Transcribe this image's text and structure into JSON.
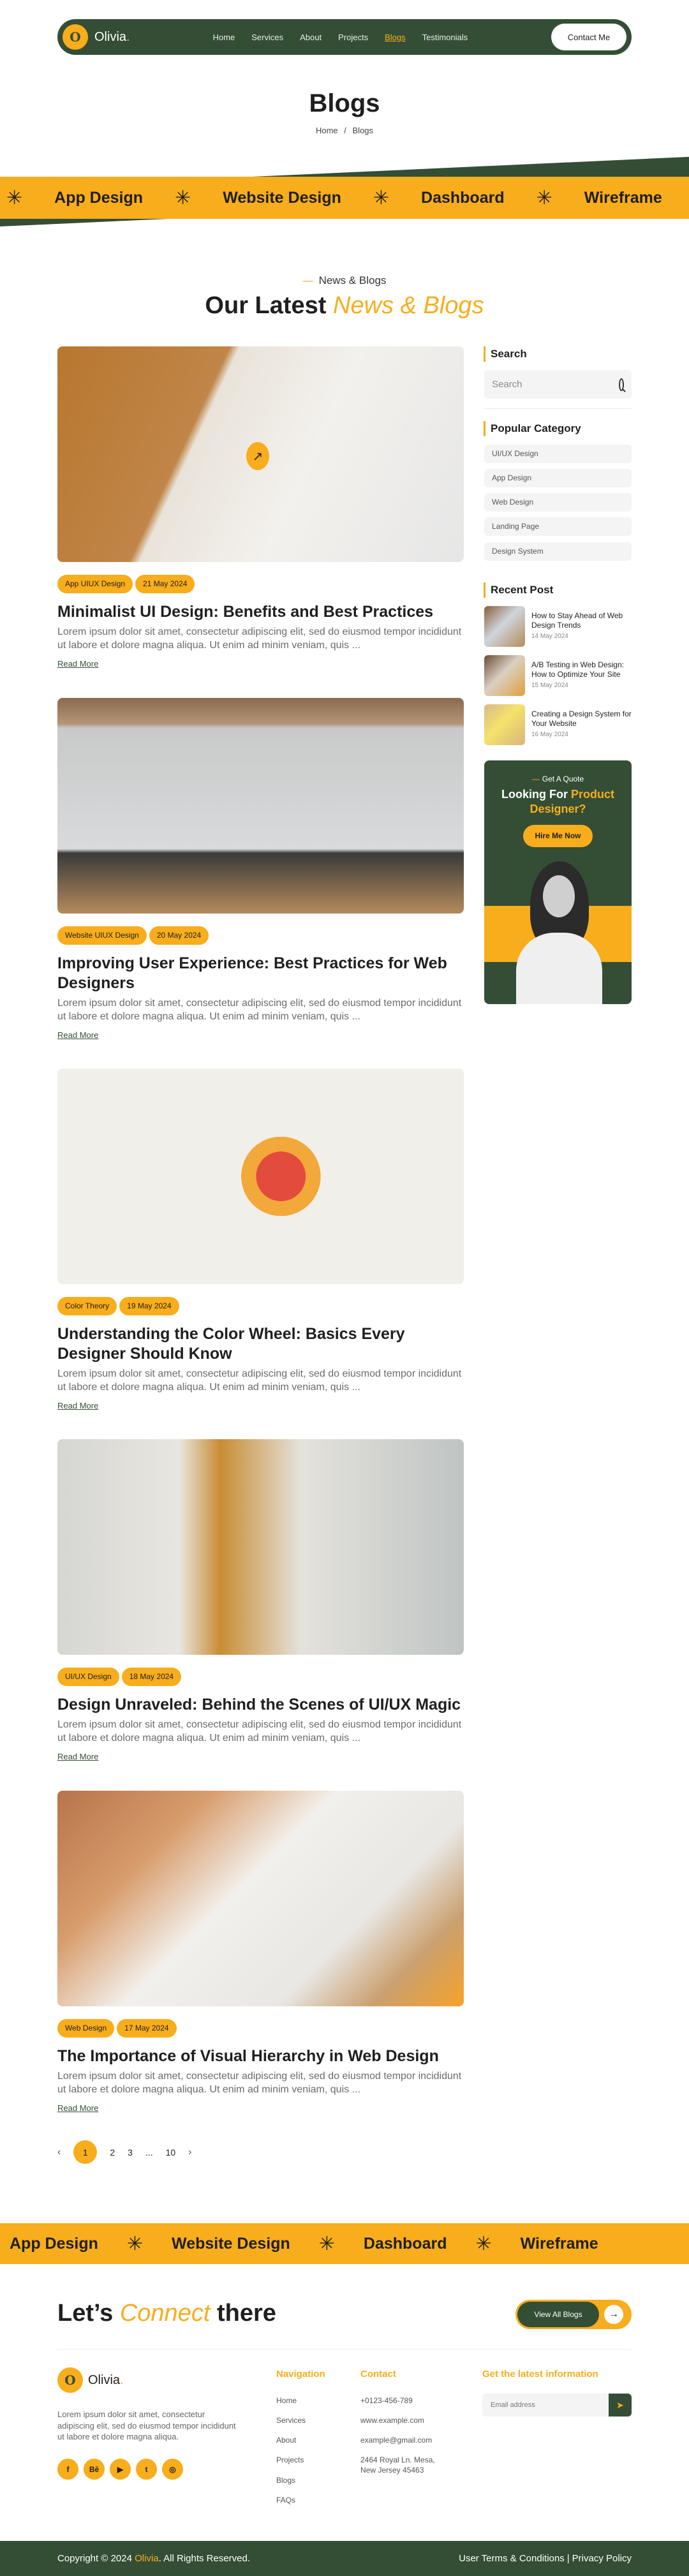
{
  "header": {
    "logo_mark": "O",
    "logo_text": "Olivia",
    "logo_dot": ".",
    "nav": [
      {
        "label": "Home",
        "active": false
      },
      {
        "label": "Services",
        "active": false
      },
      {
        "label": "About",
        "active": false
      },
      {
        "label": "Projects",
        "active": false
      },
      {
        "label": "Blogs",
        "active": true
      },
      {
        "label": "Testimonials",
        "active": false
      }
    ],
    "contact_label": "Contact Me"
  },
  "hero": {
    "title": "Blogs",
    "breadcrumb": {
      "home": "Home",
      "separator": "/",
      "current": "Blogs"
    }
  },
  "marquee": {
    "items": [
      "App Design",
      "Website Design",
      "Dashboard",
      "Wireframe"
    ],
    "star_icon": "✳"
  },
  "section": {
    "eyebrow": "News & Blogs",
    "title_main": "Our Latest",
    "title_accent": "News & Blogs"
  },
  "posts": [
    {
      "category": "App UIUX Design",
      "date": "21 May 2024",
      "title": "Minimalist UI Design: Benefits and Best Practices",
      "excerpt": "Lorem ipsum dolor sit amet, consectetur adipiscing elit, sed do eiusmod tempor incididunt ut labore et dolore magna aliqua. Ut enim ad minim veniam, quis ...",
      "read_more": "Read More"
    },
    {
      "category": "Website UIUX Design",
      "date": "20 May 2024",
      "title": "Improving User Experience: Best Practices for Web Designers",
      "excerpt": "Lorem ipsum dolor sit amet, consectetur adipiscing elit, sed do eiusmod tempor incididunt ut labore et dolore magna aliqua. Ut enim ad minim veniam, quis ...",
      "read_more": "Read More"
    },
    {
      "category": "Color Theory",
      "date": "19 May 2024",
      "title": "Understanding the Color Wheel: Basics Every Designer Should Know",
      "excerpt": "Lorem ipsum dolor sit amet, consectetur adipiscing elit, sed do eiusmod tempor incididunt ut labore et dolore magna aliqua. Ut enim ad minim veniam, quis ...",
      "read_more": "Read More"
    },
    {
      "category": "UI/UX Design",
      "date": "18 May 2024",
      "title": "Design Unraveled: Behind the Scenes of UI/UX Magic",
      "excerpt": "Lorem ipsum dolor sit amet, consectetur adipiscing elit, sed do eiusmod tempor incididunt ut labore et dolore magna aliqua. Ut enim ad minim veniam, quis ...",
      "read_more": "Read More"
    },
    {
      "category": "Web Design",
      "date": "17 May 2024",
      "title": "The Importance of Visual Hierarchy in Web Design",
      "excerpt": "Lorem ipsum dolor sit amet, consectetur adipiscing elit, sed do eiusmod tempor incididunt ut labore et dolore magna aliqua. Ut enim ad minim veniam, quis ...",
      "read_more": "Read More"
    }
  ],
  "sidebar": {
    "search_title": "Search",
    "search_placeholder": "Search",
    "category_title": "Popular Category",
    "categories": [
      "UI/UX Design",
      "App Design",
      "Web Design",
      "Landing Page",
      "Design System"
    ],
    "recent_title": "Recent Post",
    "recent": [
      {
        "title": "How to Stay Ahead of Web Design Trends",
        "date": "14 May 2024"
      },
      {
        "title": "A/B Testing in Web Design: How to Optimize Your Site",
        "date": "15 May 2024"
      },
      {
        "title": "Creating a Design System for Your Website",
        "date": "16 May 2024"
      }
    ],
    "quote": {
      "eyebrow": "Get A Quote",
      "title_main": "Looking For",
      "title_accent": "Product Designer?",
      "button": "Hire Me Now"
    }
  },
  "pagination": {
    "prev_icon": "‹",
    "pages": [
      "1",
      "2",
      "3",
      "...",
      "10"
    ],
    "current": "1",
    "next_icon": "›"
  },
  "connect": {
    "title_start": "Let’s",
    "title_accent": "Connect",
    "title_end": "there",
    "button": "View All Blogs",
    "button_icon": "→"
  },
  "footer": {
    "about": "Lorem ipsum dolor sit amet, consectetur adipiscing elit, sed do eiusmod tempor incididunt ut labore et dolore magna aliqua.",
    "socials": [
      {
        "name": "facebook",
        "glyph": "f"
      },
      {
        "name": "behance",
        "glyph": "Bē"
      },
      {
        "name": "youtube",
        "glyph": "▶"
      },
      {
        "name": "twitter",
        "glyph": "t"
      },
      {
        "name": "instagram",
        "glyph": "◎"
      }
    ],
    "navigation_title": "Navigation",
    "navigation": [
      "Home",
      "Services",
      "About",
      "Projects",
      "Blogs",
      "FAQs"
    ],
    "contact_title": "Contact",
    "contact": {
      "phone": "+0123-456-789",
      "website": "www.example.com",
      "email": "example@gmail.com",
      "address_line1": "2464 Royal Ln. Mesa,",
      "address_line2": "New Jersey 45463"
    },
    "newsletter_title": "Get the latest information",
    "newsletter_placeholder": "Email address",
    "send_icon": "➤",
    "copyright_start": "Copyright © 2024",
    "copyright_brand": "Olivia",
    "copyright_end": ". All Rights Reserved.",
    "terms": "User Terms & Conditions",
    "legal_separator": "|",
    "privacy": "Privacy Policy"
  },
  "colors": {
    "brand_green": "#344e36",
    "accent_yellow": "#f8ad1c",
    "text_dark": "#1f1f1f"
  }
}
